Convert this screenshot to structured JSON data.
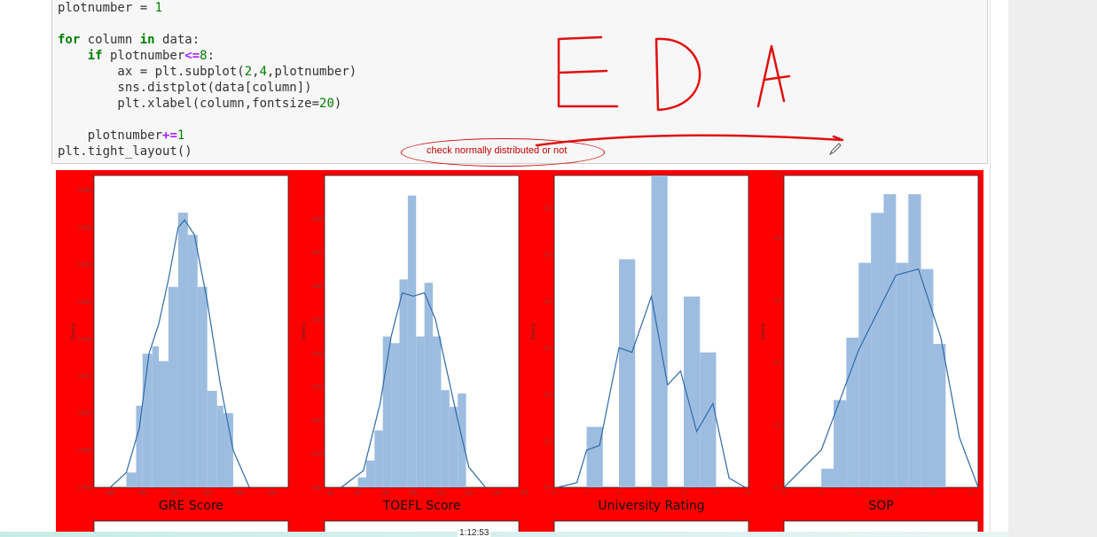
{
  "code": {
    "lines": [
      "plotnumber = 1",
      "",
      "for column in data:",
      "    if plotnumber<=8:",
      "        ax = plt.subplot(2,4,plotnumber)",
      "        sns.distplot(data[column])",
      "        plt.xlabel(column,fontsize=20)",
      "",
      "    plotnumber+=1",
      "plt.tight_layout()"
    ]
  },
  "annotations": {
    "handwritten_title": "EDA",
    "bubble_text": "check normally distributed or not"
  },
  "player": {
    "timestamp": "1:12:53"
  },
  "colors": {
    "panel_background": "#ff0000",
    "bar_color": "#9dbde0",
    "kde_color": "#2f6aa6",
    "annotation_color": "#d01010"
  },
  "chart_data": [
    {
      "type": "bar",
      "xlabel": "GRE Score",
      "ylabel": "Density",
      "xlim": [
        285,
        345
      ],
      "ylim": [
        0,
        0.042
      ],
      "xticks": [
        "290",
        "300",
        "310",
        "320",
        "330",
        "340",
        "350"
      ],
      "yticks": [
        "0.000",
        "0.005",
        "0.010",
        "0.015",
        "0.020",
        "0.025",
        "0.030",
        "0.035",
        "0.040"
      ],
      "bins": [
        {
          "start": 295,
          "end": 298,
          "value": 0.002
        },
        {
          "start": 298,
          "end": 300,
          "value": 0.011
        },
        {
          "start": 300,
          "end": 303,
          "value": 0.018
        },
        {
          "start": 303,
          "end": 305,
          "value": 0.019
        },
        {
          "start": 305,
          "end": 308,
          "value": 0.017
        },
        {
          "start": 308,
          "end": 311,
          "value": 0.027
        },
        {
          "start": 311,
          "end": 314,
          "value": 0.037
        },
        {
          "start": 314,
          "end": 317,
          "value": 0.034
        },
        {
          "start": 317,
          "end": 320,
          "value": 0.027
        },
        {
          "start": 320,
          "end": 323,
          "value": 0.013
        },
        {
          "start": 323,
          "end": 325,
          "value": 0.011
        },
        {
          "start": 325,
          "end": 328,
          "value": 0.01
        }
      ],
      "kde": [
        [
          290,
          0.0
        ],
        [
          295,
          0.002
        ],
        [
          299,
          0.008
        ],
        [
          302,
          0.018
        ],
        [
          305,
          0.022
        ],
        [
          308,
          0.028
        ],
        [
          311,
          0.035
        ],
        [
          313,
          0.036
        ],
        [
          316,
          0.034
        ],
        [
          320,
          0.025
        ],
        [
          324,
          0.014
        ],
        [
          328,
          0.005
        ],
        [
          333,
          0.0
        ]
      ]
    },
    {
      "type": "bar",
      "xlabel": "TOEFL Score",
      "ylabel": "Density",
      "xlim": [
        89,
        124
      ],
      "ylim": [
        0,
        0.093
      ],
      "xticks": [
        "90",
        "95",
        "100",
        "105",
        "110",
        "115",
        "120",
        "125"
      ],
      "yticks": [
        "0.00",
        "0.01",
        "0.02",
        "0.03",
        "0.04",
        "0.05",
        "0.06",
        "0.07",
        "0.08"
      ],
      "bins": [
        {
          "start": 95,
          "end": 96.5,
          "value": 0.003
        },
        {
          "start": 96.5,
          "end": 98,
          "value": 0.008
        },
        {
          "start": 98,
          "end": 99.5,
          "value": 0.017
        },
        {
          "start": 99.5,
          "end": 101,
          "value": 0.045
        },
        {
          "start": 101,
          "end": 102.5,
          "value": 0.043
        },
        {
          "start": 102.5,
          "end": 104,
          "value": 0.062
        },
        {
          "start": 104,
          "end": 105.5,
          "value": 0.087
        },
        {
          "start": 105.5,
          "end": 107,
          "value": 0.045
        },
        {
          "start": 107,
          "end": 108.5,
          "value": 0.061
        },
        {
          "start": 108.5,
          "end": 110,
          "value": 0.045
        },
        {
          "start": 110,
          "end": 111.5,
          "value": 0.029
        },
        {
          "start": 111.5,
          "end": 113,
          "value": 0.024
        },
        {
          "start": 113,
          "end": 114.5,
          "value": 0.028
        }
      ],
      "kde": [
        [
          92,
          0.0
        ],
        [
          96,
          0.005
        ],
        [
          99,
          0.025
        ],
        [
          101,
          0.045
        ],
        [
          103,
          0.058
        ],
        [
          105,
          0.057
        ],
        [
          107,
          0.058
        ],
        [
          109,
          0.05
        ],
        [
          111,
          0.035
        ],
        [
          113,
          0.02
        ],
        [
          115,
          0.006
        ],
        [
          118,
          0.0
        ]
      ]
    },
    {
      "type": "bar",
      "xlabel": "University Rating",
      "ylabel": "Density",
      "xlim": [
        0,
        6
      ],
      "ylim": [
        0,
        0.67
      ],
      "xticks": [
        "0",
        "1",
        "2",
        "3",
        "4",
        "5",
        "6"
      ],
      "yticks": [
        "0.0",
        "0.1",
        "0.2",
        "0.3",
        "0.4",
        "0.5",
        "0.6"
      ],
      "bins": [
        {
          "start": 1.0,
          "end": 1.5,
          "value": 0.13
        },
        {
          "start": 2.0,
          "end": 2.5,
          "value": 0.49
        },
        {
          "start": 3.0,
          "end": 3.5,
          "value": 0.67
        },
        {
          "start": 4.0,
          "end": 4.5,
          "value": 0.41
        },
        {
          "start": 4.5,
          "end": 5.0,
          "value": 0.29
        }
      ],
      "kde": [
        [
          0.1,
          0.0
        ],
        [
          0.7,
          0.01
        ],
        [
          1.0,
          0.08
        ],
        [
          1.4,
          0.09
        ],
        [
          2.0,
          0.3
        ],
        [
          2.4,
          0.29
        ],
        [
          3.0,
          0.41
        ],
        [
          3.5,
          0.22
        ],
        [
          3.9,
          0.25
        ],
        [
          4.4,
          0.12
        ],
        [
          4.9,
          0.18
        ],
        [
          5.4,
          0.02
        ],
        [
          5.9,
          0.0
        ]
      ]
    },
    {
      "type": "bar",
      "xlabel": "SOP",
      "ylabel": "Density",
      "xlim": [
        0,
        5.2
      ],
      "ylim": [
        0,
        0.5
      ],
      "xticks": [
        "0",
        "1",
        "2",
        "3",
        "4",
        "5"
      ],
      "yticks": [
        "0.0",
        "0.1",
        "0.2",
        "0.3",
        "0.4",
        "0.5"
      ],
      "bins": [
        {
          "start": 1.0,
          "end": 1.33,
          "value": 0.03
        },
        {
          "start": 1.33,
          "end": 1.67,
          "value": 0.14
        },
        {
          "start": 1.67,
          "end": 2.0,
          "value": 0.24
        },
        {
          "start": 2.0,
          "end": 2.33,
          "value": 0.36
        },
        {
          "start": 2.33,
          "end": 2.67,
          "value": 0.44
        },
        {
          "start": 2.67,
          "end": 3.0,
          "value": 0.47
        },
        {
          "start": 3.0,
          "end": 3.33,
          "value": 0.36
        },
        {
          "start": 3.33,
          "end": 3.67,
          "value": 0.47
        },
        {
          "start": 3.67,
          "end": 4.0,
          "value": 0.35
        },
        {
          "start": 4.0,
          "end": 4.33,
          "value": 0.23
        }
      ],
      "kde": [
        [
          0,
          0.0
        ],
        [
          1.0,
          0.06
        ],
        [
          2.0,
          0.22
        ],
        [
          3.0,
          0.34
        ],
        [
          3.6,
          0.35
        ],
        [
          4.2,
          0.24
        ],
        [
          4.7,
          0.08
        ],
        [
          5.2,
          0.0
        ]
      ]
    }
  ]
}
